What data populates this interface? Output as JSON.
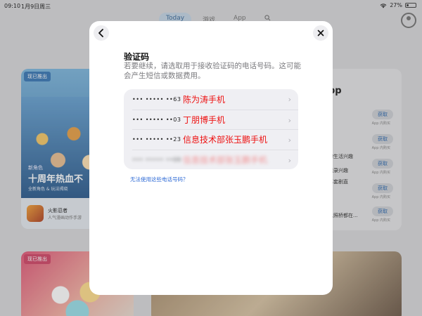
{
  "status_bar": {
    "time": "09:10",
    "date": "1月9日周三",
    "battery": "27%",
    "battery_level": 0.27,
    "wifi_icon": "wifi-icon"
  },
  "background": {
    "tabs": [
      "Today",
      "游戏",
      "App",
      ""
    ],
    "card1": {
      "tag": "现已推出",
      "eyebrow": "新角色",
      "headline": "十周年热血不",
      "subline": "全新角色 & 玩法揭晓",
      "app_name": "火影忍者",
      "app_desc": "人气漫画动作手游"
    },
    "card_right": {
      "headline": "pp",
      "lines": [
        "的生活兴趣",
        "记录兴趣",
        "幕套剧直",
        "",
        "也照桥都在..."
      ],
      "get_label": "获取",
      "iap_label": "App 内购买"
    },
    "card2": {
      "tag": "现已推出"
    }
  },
  "modal": {
    "title": "验证码",
    "description": "若要继续，请选取用于接收验证码的电话号码。这可能会产生短信或数据费用。",
    "phones": [
      {
        "masked": "••• ••••• ••63",
        "annotation": "陈为涛手机",
        "blurred": false
      },
      {
        "masked": "••• ••••• ••03",
        "annotation": "丁朋博手机",
        "blurred": false
      },
      {
        "masked": "••• ••••• ••23",
        "annotation": "信息技术部张玉鹏手机",
        "blurred": false
      },
      {
        "masked": "••• ••••• ••09",
        "annotation": "信息技术部张玉鹏手机",
        "blurred": true
      }
    ],
    "unusable_link": "无法使用这些电话号码？",
    "back_icon": "chevron-left-icon",
    "close_icon": "close-icon"
  }
}
